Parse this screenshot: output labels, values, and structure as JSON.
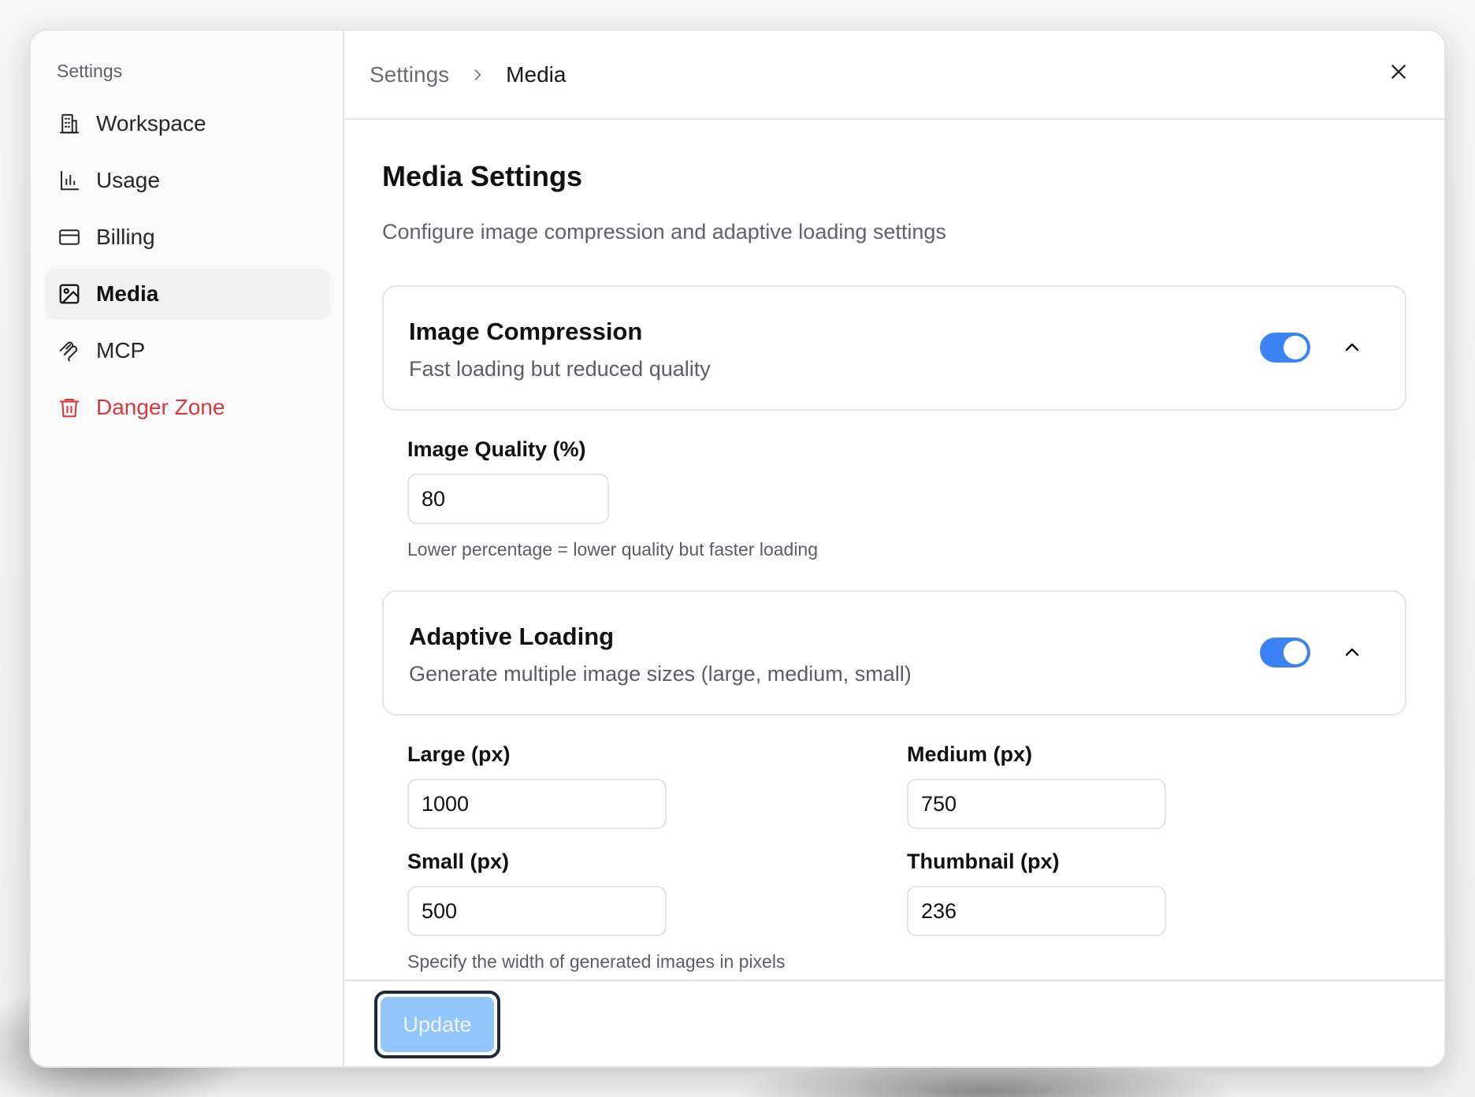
{
  "sidebar": {
    "heading": "Settings",
    "items": [
      {
        "label": "Workspace",
        "icon": "building-icon"
      },
      {
        "label": "Usage",
        "icon": "bar-chart-icon"
      },
      {
        "label": "Billing",
        "icon": "credit-card-icon"
      },
      {
        "label": "Media",
        "icon": "image-icon",
        "active": true
      },
      {
        "label": "MCP",
        "icon": "mcp-icon"
      },
      {
        "label": "Danger Zone",
        "icon": "trash-icon",
        "danger": true
      }
    ]
  },
  "breadcrumb": {
    "parent": "Settings",
    "current": "Media"
  },
  "page": {
    "title": "Media Settings",
    "description": "Configure image compression and adaptive loading settings"
  },
  "compression": {
    "title": "Image Compression",
    "subtitle": "Fast loading but reduced quality",
    "enabled": true,
    "quality_label": "Image Quality (%)",
    "quality_value": "80",
    "quality_hint": "Lower percentage = lower quality but faster loading"
  },
  "adaptive": {
    "title": "Adaptive Loading",
    "subtitle": "Generate multiple image sizes (large, medium, small)",
    "enabled": true,
    "large_label": "Large (px)",
    "large_value": "1000",
    "medium_label": "Medium (px)",
    "medium_value": "750",
    "small_label": "Small (px)",
    "small_value": "500",
    "thumbnail_label": "Thumbnail (px)",
    "thumbnail_value": "236",
    "hint": "Specify the width of generated images in pixels"
  },
  "footer": {
    "update_label": "Update"
  },
  "colors": {
    "accent": "#3b82f6",
    "update_button": "#93c5fd",
    "danger": "#d63b3b"
  }
}
